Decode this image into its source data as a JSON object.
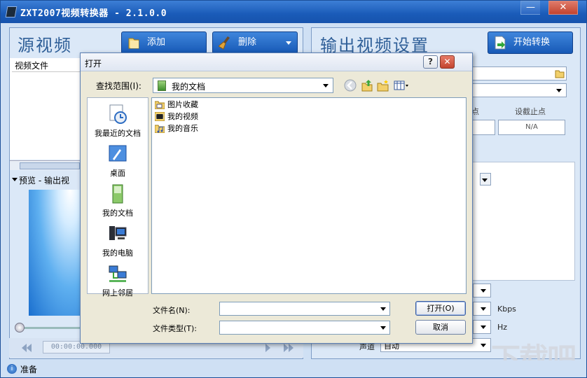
{
  "app": {
    "title": "ZXT2007视频转换器 - 2.1.0.0",
    "window_controls": {
      "minimize": "—",
      "maximize": "□",
      "close": "✕"
    }
  },
  "left_panel": {
    "title": "源视频",
    "add_label": "添加",
    "delete_label": "删除",
    "list_header": "视频文件",
    "preview_label": "预览 - 输出视",
    "time": "00:00:00.000"
  },
  "right_panel": {
    "title": "输出视频设置",
    "start_label": "开始转换",
    "start_point_label": "点",
    "end_point_label": "设截止点",
    "end_point_value": "N/A",
    "units": [
      "Kbps",
      "Hz"
    ],
    "channel_label": "声道",
    "channel_value": "自动"
  },
  "status": {
    "text": "准备"
  },
  "watermark": "下载吧",
  "dialog": {
    "title": "打开",
    "help": "?",
    "close": "✕",
    "look_in_label": "查找范围(I):",
    "look_in_value": "我的文档",
    "places": [
      {
        "label": "我最近的文档",
        "icon": "recent-documents-icon"
      },
      {
        "label": "桌面",
        "icon": "desktop-icon"
      },
      {
        "label": "我的文档",
        "icon": "my-documents-icon"
      },
      {
        "label": "我的电脑",
        "icon": "my-computer-icon"
      },
      {
        "label": "网上邻居",
        "icon": "network-places-icon"
      }
    ],
    "files": [
      {
        "name": "图片收藏",
        "icon": "pictures-folder-icon"
      },
      {
        "name": "我的视频",
        "icon": "videos-folder-icon"
      },
      {
        "name": "我的音乐",
        "icon": "music-folder-icon"
      }
    ],
    "filename_label": "文件名(N):",
    "filetype_label": "文件类型(T):",
    "open_label": "打开(O)",
    "cancel_label": "取消"
  },
  "colors": {
    "accent": "#1a5bb8",
    "panel_bg": "#dbe8f7",
    "dialog_bg": "#ece9d8"
  }
}
